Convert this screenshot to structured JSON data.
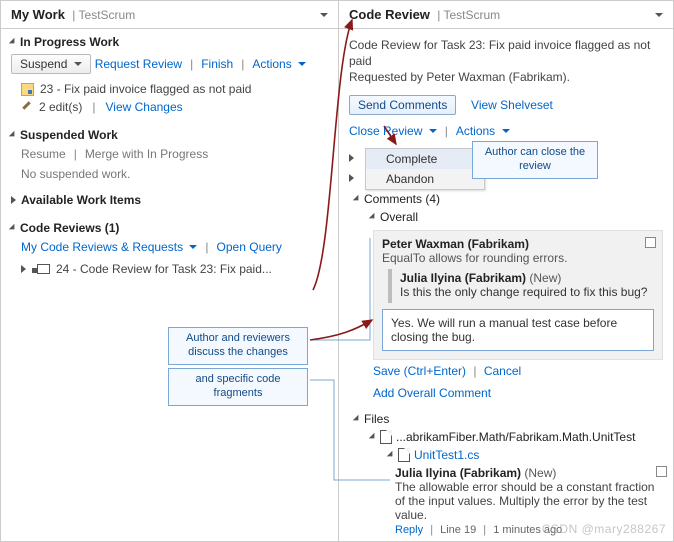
{
  "left": {
    "title": "My Work",
    "project": "TestScrum",
    "inProgress": {
      "title": "In Progress Work",
      "suspend": "Suspend",
      "requestReview": "Request Review",
      "finish": "Finish",
      "actions": "Actions",
      "taskDesc": "23 - Fix paid invoice flagged as not paid",
      "edits": "2 edit(s)",
      "viewChanges": "View Changes"
    },
    "suspended": {
      "title": "Suspended Work",
      "resume": "Resume",
      "merge": "Merge with In Progress",
      "empty": "No suspended work."
    },
    "available": {
      "title": "Available Work Items"
    },
    "codeReviews": {
      "title": "Code Reviews (1)",
      "myReviews": "My Code Reviews & Requests",
      "openQuery": "Open Query",
      "item": "24 - Code Review for Task 23: Fix paid..."
    }
  },
  "right": {
    "title": "Code Review",
    "project": "TestScrum",
    "descLine1": "Code Review for Task 23: Fix paid invoice flagged as not paid",
    "descLine2": "Requested by Peter Waxman (Fabrikam).",
    "sendComments": "Send Comments",
    "viewShelveset": "View Shelveset",
    "closeReview": "Close Review",
    "actions": "Actions",
    "menu": {
      "complete": "Complete",
      "abandon": "Abandon"
    },
    "commentsHdr": "Comments (4)",
    "overall": "Overall",
    "thread": {
      "author": "Peter Waxman (Fabrikam)",
      "body": "EqualTo allows for rounding errors.",
      "reply": {
        "author": "Julia Ilyina (Fabrikam)",
        "newTag": "(New)",
        "body": "Is this the only change required to fix this bug?"
      },
      "replyInput": "Yes. We will run a manual test case before closing the bug."
    },
    "save": "Save (Ctrl+Enter)",
    "cancel": "Cancel",
    "addOverall": "Add Overall Comment",
    "files": {
      "hdr": "Files",
      "path": "...abrikamFiber.Math/Fabrikam.Math.UnitTest",
      "file": "UnitTest1.cs",
      "comment": {
        "author": "Julia Ilyina (Fabrikam)",
        "newTag": "(New)",
        "body": "The allowable error should be a constant fraction of the input values. Multiply the error by the test value.",
        "reply": "Reply",
        "line": "Line 19",
        "time": "1 minutes ago"
      }
    }
  },
  "callouts": {
    "close": "Author can close the review",
    "discuss": "Author and reviewers discuss the changes",
    "fragments": "and specific code fragments"
  },
  "watermark": "CSDN @mary288267"
}
